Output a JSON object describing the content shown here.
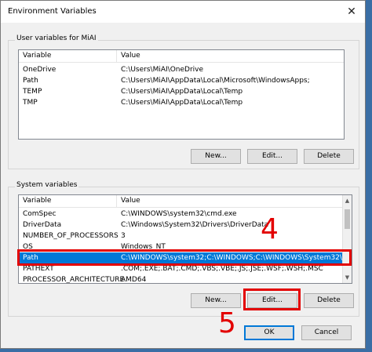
{
  "window": {
    "title": "Environment Variables",
    "close": "✕"
  },
  "user_group": {
    "label": "User variables for MiAI"
  },
  "columns": {
    "variable": "Variable",
    "value": "Value"
  },
  "user_vars": [
    {
      "name": "OneDrive",
      "value": "C:\\Users\\MiAI\\OneDrive"
    },
    {
      "name": "Path",
      "value": "C:\\Users\\MiAI\\AppData\\Local\\Microsoft\\WindowsApps;"
    },
    {
      "name": "TEMP",
      "value": "C:\\Users\\MiAI\\AppData\\Local\\Temp"
    },
    {
      "name": "TMP",
      "value": "C:\\Users\\MiAI\\AppData\\Local\\Temp"
    }
  ],
  "user_buttons": {
    "new": "New...",
    "edit": "Edit...",
    "delete": "Delete"
  },
  "system_group": {
    "label": "System variables"
  },
  "system_vars": [
    {
      "name": "ComSpec",
      "value": "C:\\WINDOWS\\system32\\cmd.exe"
    },
    {
      "name": "DriverData",
      "value": "C:\\Windows\\System32\\Drivers\\DriverData"
    },
    {
      "name": "NUMBER_OF_PROCESSORS",
      "value": "3"
    },
    {
      "name": "OS",
      "value": "Windows_NT"
    },
    {
      "name": "Path",
      "value": "C:\\WINDOWS\\system32;C:\\WINDOWS;C:\\WINDOWS\\System32\\Wb..."
    },
    {
      "name": "PATHEXT",
      "value": ".COM;.EXE;.BAT;.CMD;.VBS;.VBE;.JS;.JSE;.WSF;.WSH;.MSC"
    },
    {
      "name": "PROCESSOR_ARCHITECTURE",
      "value": "AMD64"
    }
  ],
  "selected_system_row": "Path",
  "system_buttons": {
    "new": "New...",
    "edit": "Edit...",
    "delete": "Delete"
  },
  "dialog_buttons": {
    "ok": "OK",
    "cancel": "Cancel"
  },
  "annotations": {
    "step4": "4",
    "step5": "5",
    "color": "#e30000"
  },
  "colors": {
    "selection": "#0078d7"
  }
}
